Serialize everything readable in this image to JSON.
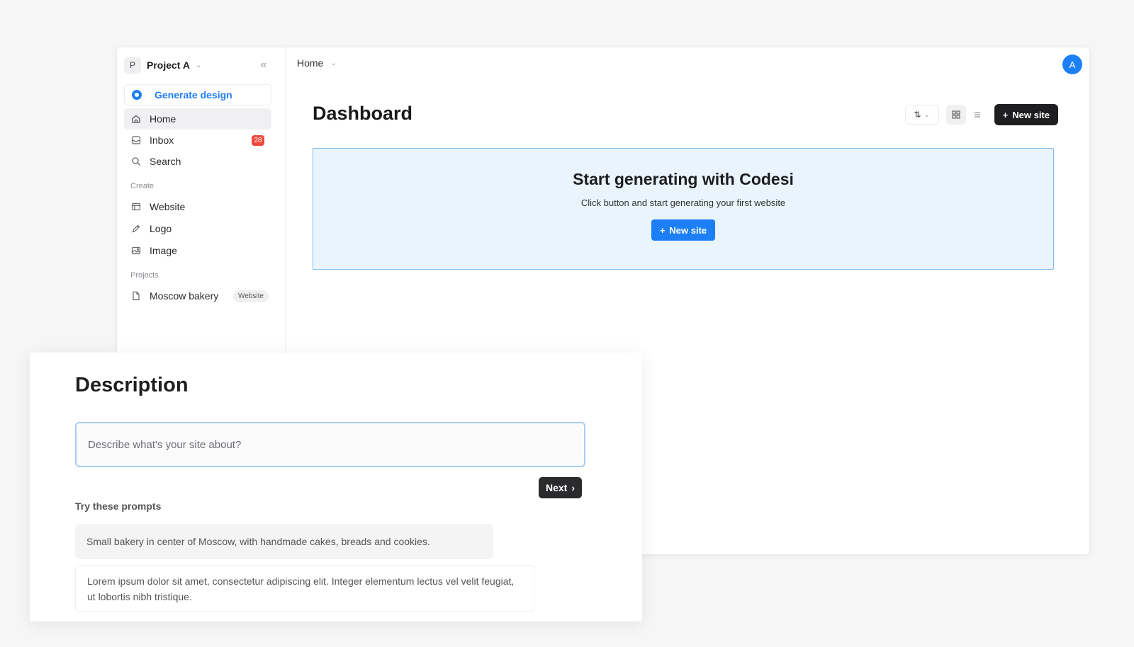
{
  "sidebar": {
    "project": {
      "initial": "P",
      "name": "Project A"
    },
    "generate_label": "Generate design",
    "nav": [
      {
        "label": "Home",
        "icon": "home-icon"
      },
      {
        "label": "Inbox",
        "icon": "inbox-icon",
        "badge": "28"
      },
      {
        "label": "Search",
        "icon": "search-icon"
      }
    ],
    "create_label": "Create",
    "create_items": [
      {
        "label": "Website",
        "icon": "browser-window-icon"
      },
      {
        "label": "Logo",
        "icon": "pen-icon"
      },
      {
        "label": "Image",
        "icon": "image-icon"
      }
    ],
    "projects_label": "Projects",
    "projects": [
      {
        "label": "Moscow bakery",
        "tag": "Website",
        "icon": "file-icon"
      }
    ]
  },
  "main": {
    "breadcrumb": "Home",
    "user_initial": "A",
    "title": "Dashboard",
    "new_site_label": "New site",
    "hero": {
      "title": "Start generating with Codesi",
      "subtitle": "Click button and start generating your first website",
      "button_label": "New site"
    }
  },
  "description": {
    "title": "Description",
    "input_placeholder": "Describe what's your site about?",
    "next_label": "Next",
    "prompts_label": "Try these prompts",
    "prompts": [
      "Small bakery in center of Moscow, with handmade cakes, breads and cookies.",
      "Lorem ipsum dolor sit amet, consectetur adipiscing elit. Integer elementum lectus vel velit feugiat, ut lobortis nibh tristique."
    ]
  },
  "colors": {
    "accent": "#1d7ff5",
    "hero_bg": "#e9f4fd",
    "badge": "#ef4a3c",
    "dark_button": "#1e1e21"
  }
}
